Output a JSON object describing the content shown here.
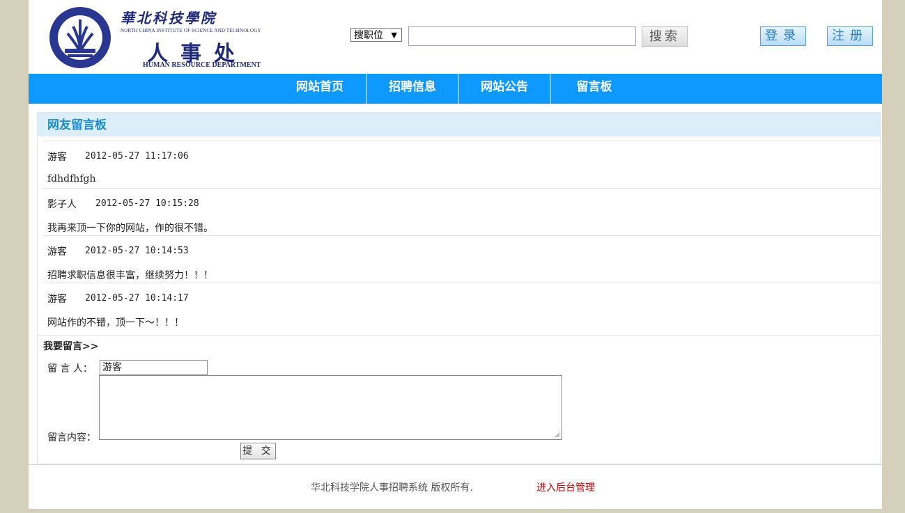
{
  "header": {
    "logo": {
      "school_cn": "華北科技學院",
      "school_en": "NORTH CHINA INSTITUTE OF SCIENCE AND TECHNOLOGY",
      "dept_cn": "人事处",
      "dept_en": "HUMAN RESOURCE DEPARTMENT"
    },
    "search": {
      "select_value": "搜职位",
      "input_value": "",
      "button_label": "搜索"
    },
    "login_label": "登录",
    "register_label": "注册"
  },
  "nav": {
    "items": [
      {
        "label": "网站首页"
      },
      {
        "label": "招聘信息"
      },
      {
        "label": "网站公告"
      },
      {
        "label": "留言板"
      }
    ]
  },
  "board": {
    "title": "网友留言板",
    "messages": [
      {
        "author": "游客",
        "time": "2012-05-27 11:17:06",
        "content": "fdhdfhfgh"
      },
      {
        "author": "影子人",
        "time": "2012-05-27 10:15:28",
        "content": "我再来顶一下你的网站，作的很不错。"
      },
      {
        "author": "游客",
        "time": "2012-05-27 10:14:53",
        "content": "招聘求职信息很丰富，继续努力！！！"
      },
      {
        "author": "游客",
        "time": "2012-05-27 10:14:17",
        "content": "网站作的不错，顶一下～！！！"
      }
    ]
  },
  "form": {
    "title": "我要留言>>",
    "name_label": "留 言 人：",
    "name_value": "游客",
    "content_label": "留言内容：",
    "content_value": "",
    "submit_label": "提 交"
  },
  "footer": {
    "copyright": "华北科技学院人事招聘系统 版权所有.",
    "admin_link": "进入后台管理"
  },
  "colors": {
    "nav_bg": "#0d99ff",
    "board_title_bg": "#ddeefb",
    "board_title_text": "#1b8bd0",
    "admin_link": "#c00000",
    "page_bg": "#d4d0bc"
  }
}
